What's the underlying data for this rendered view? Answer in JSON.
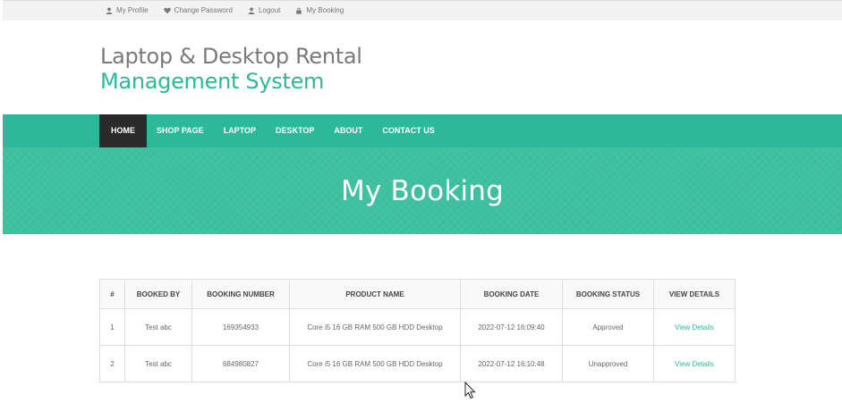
{
  "topbar": {
    "links": [
      {
        "label": "My Profile",
        "icon": "user-icon"
      },
      {
        "label": "Change Password",
        "icon": "heart-icon"
      },
      {
        "label": "Logout",
        "icon": "user-icon"
      },
      {
        "label": "My Booking",
        "icon": "lock-icon"
      }
    ]
  },
  "logo": {
    "line1": "Laptop & Desktop Rental",
    "line2": "Management System"
  },
  "nav": {
    "items": [
      "Home",
      "Shop Page",
      "Laptop",
      "Desktop",
      "About",
      "Contact Us"
    ],
    "active_index": 0
  },
  "banner": {
    "title": "My Booking"
  },
  "table": {
    "headers": [
      "#",
      "Booked By",
      "Booking Number",
      "Product Name",
      "Booking Date",
      "Booking Status",
      "View Details"
    ],
    "rows": [
      {
        "num": "1",
        "booked_by": "Test abc",
        "booking_number": "169354933",
        "product": "Core i5 16 GB RAM 500 GB HDD Desktop",
        "date": "2022-07-12 16:09:40",
        "status": "Approved",
        "link": "View Details"
      },
      {
        "num": "2",
        "booked_by": "Test abc",
        "booking_number": "684980827",
        "product": "Core i5 16 GB RAM 500 GB HDD Desktop",
        "date": "2022-07-12 16:10:48",
        "status": "Unapproved",
        "link": "View Details"
      }
    ]
  },
  "colors": {
    "accent": "#2cb999",
    "nav_active_bg": "#2b2b2b",
    "banner_bg": "#3fc0a0"
  }
}
